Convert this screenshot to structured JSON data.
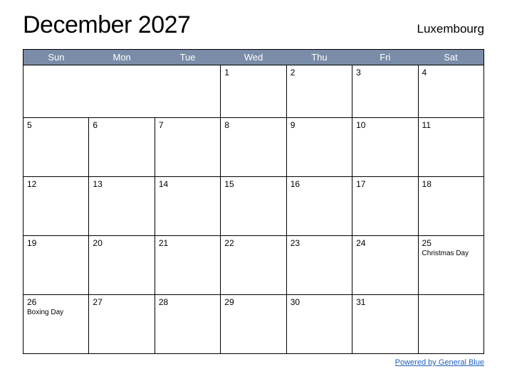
{
  "header": {
    "title": "December 2027",
    "country": "Luxembourg"
  },
  "weekdays": [
    "Sun",
    "Mon",
    "Tue",
    "Wed",
    "Thu",
    "Fri",
    "Sat"
  ],
  "weeks": [
    [
      {
        "day": "",
        "event": ""
      },
      {
        "day": "",
        "event": ""
      },
      {
        "day": "",
        "event": ""
      },
      {
        "day": "1",
        "event": ""
      },
      {
        "day": "2",
        "event": ""
      },
      {
        "day": "3",
        "event": ""
      },
      {
        "day": "4",
        "event": ""
      }
    ],
    [
      {
        "day": "5",
        "event": ""
      },
      {
        "day": "6",
        "event": ""
      },
      {
        "day": "7",
        "event": ""
      },
      {
        "day": "8",
        "event": ""
      },
      {
        "day": "9",
        "event": ""
      },
      {
        "day": "10",
        "event": ""
      },
      {
        "day": "11",
        "event": ""
      }
    ],
    [
      {
        "day": "12",
        "event": ""
      },
      {
        "day": "13",
        "event": ""
      },
      {
        "day": "14",
        "event": ""
      },
      {
        "day": "15",
        "event": ""
      },
      {
        "day": "16",
        "event": ""
      },
      {
        "day": "17",
        "event": ""
      },
      {
        "day": "18",
        "event": ""
      }
    ],
    [
      {
        "day": "19",
        "event": ""
      },
      {
        "day": "20",
        "event": ""
      },
      {
        "day": "21",
        "event": ""
      },
      {
        "day": "22",
        "event": ""
      },
      {
        "day": "23",
        "event": ""
      },
      {
        "day": "24",
        "event": ""
      },
      {
        "day": "25",
        "event": "Christmas Day"
      }
    ],
    [
      {
        "day": "26",
        "event": "Boxing Day"
      },
      {
        "day": "27",
        "event": ""
      },
      {
        "day": "28",
        "event": ""
      },
      {
        "day": "29",
        "event": ""
      },
      {
        "day": "30",
        "event": ""
      },
      {
        "day": "31",
        "event": ""
      },
      {
        "day": "",
        "event": ""
      }
    ]
  ],
  "footer": {
    "link_text": "Powered by General Blue"
  }
}
